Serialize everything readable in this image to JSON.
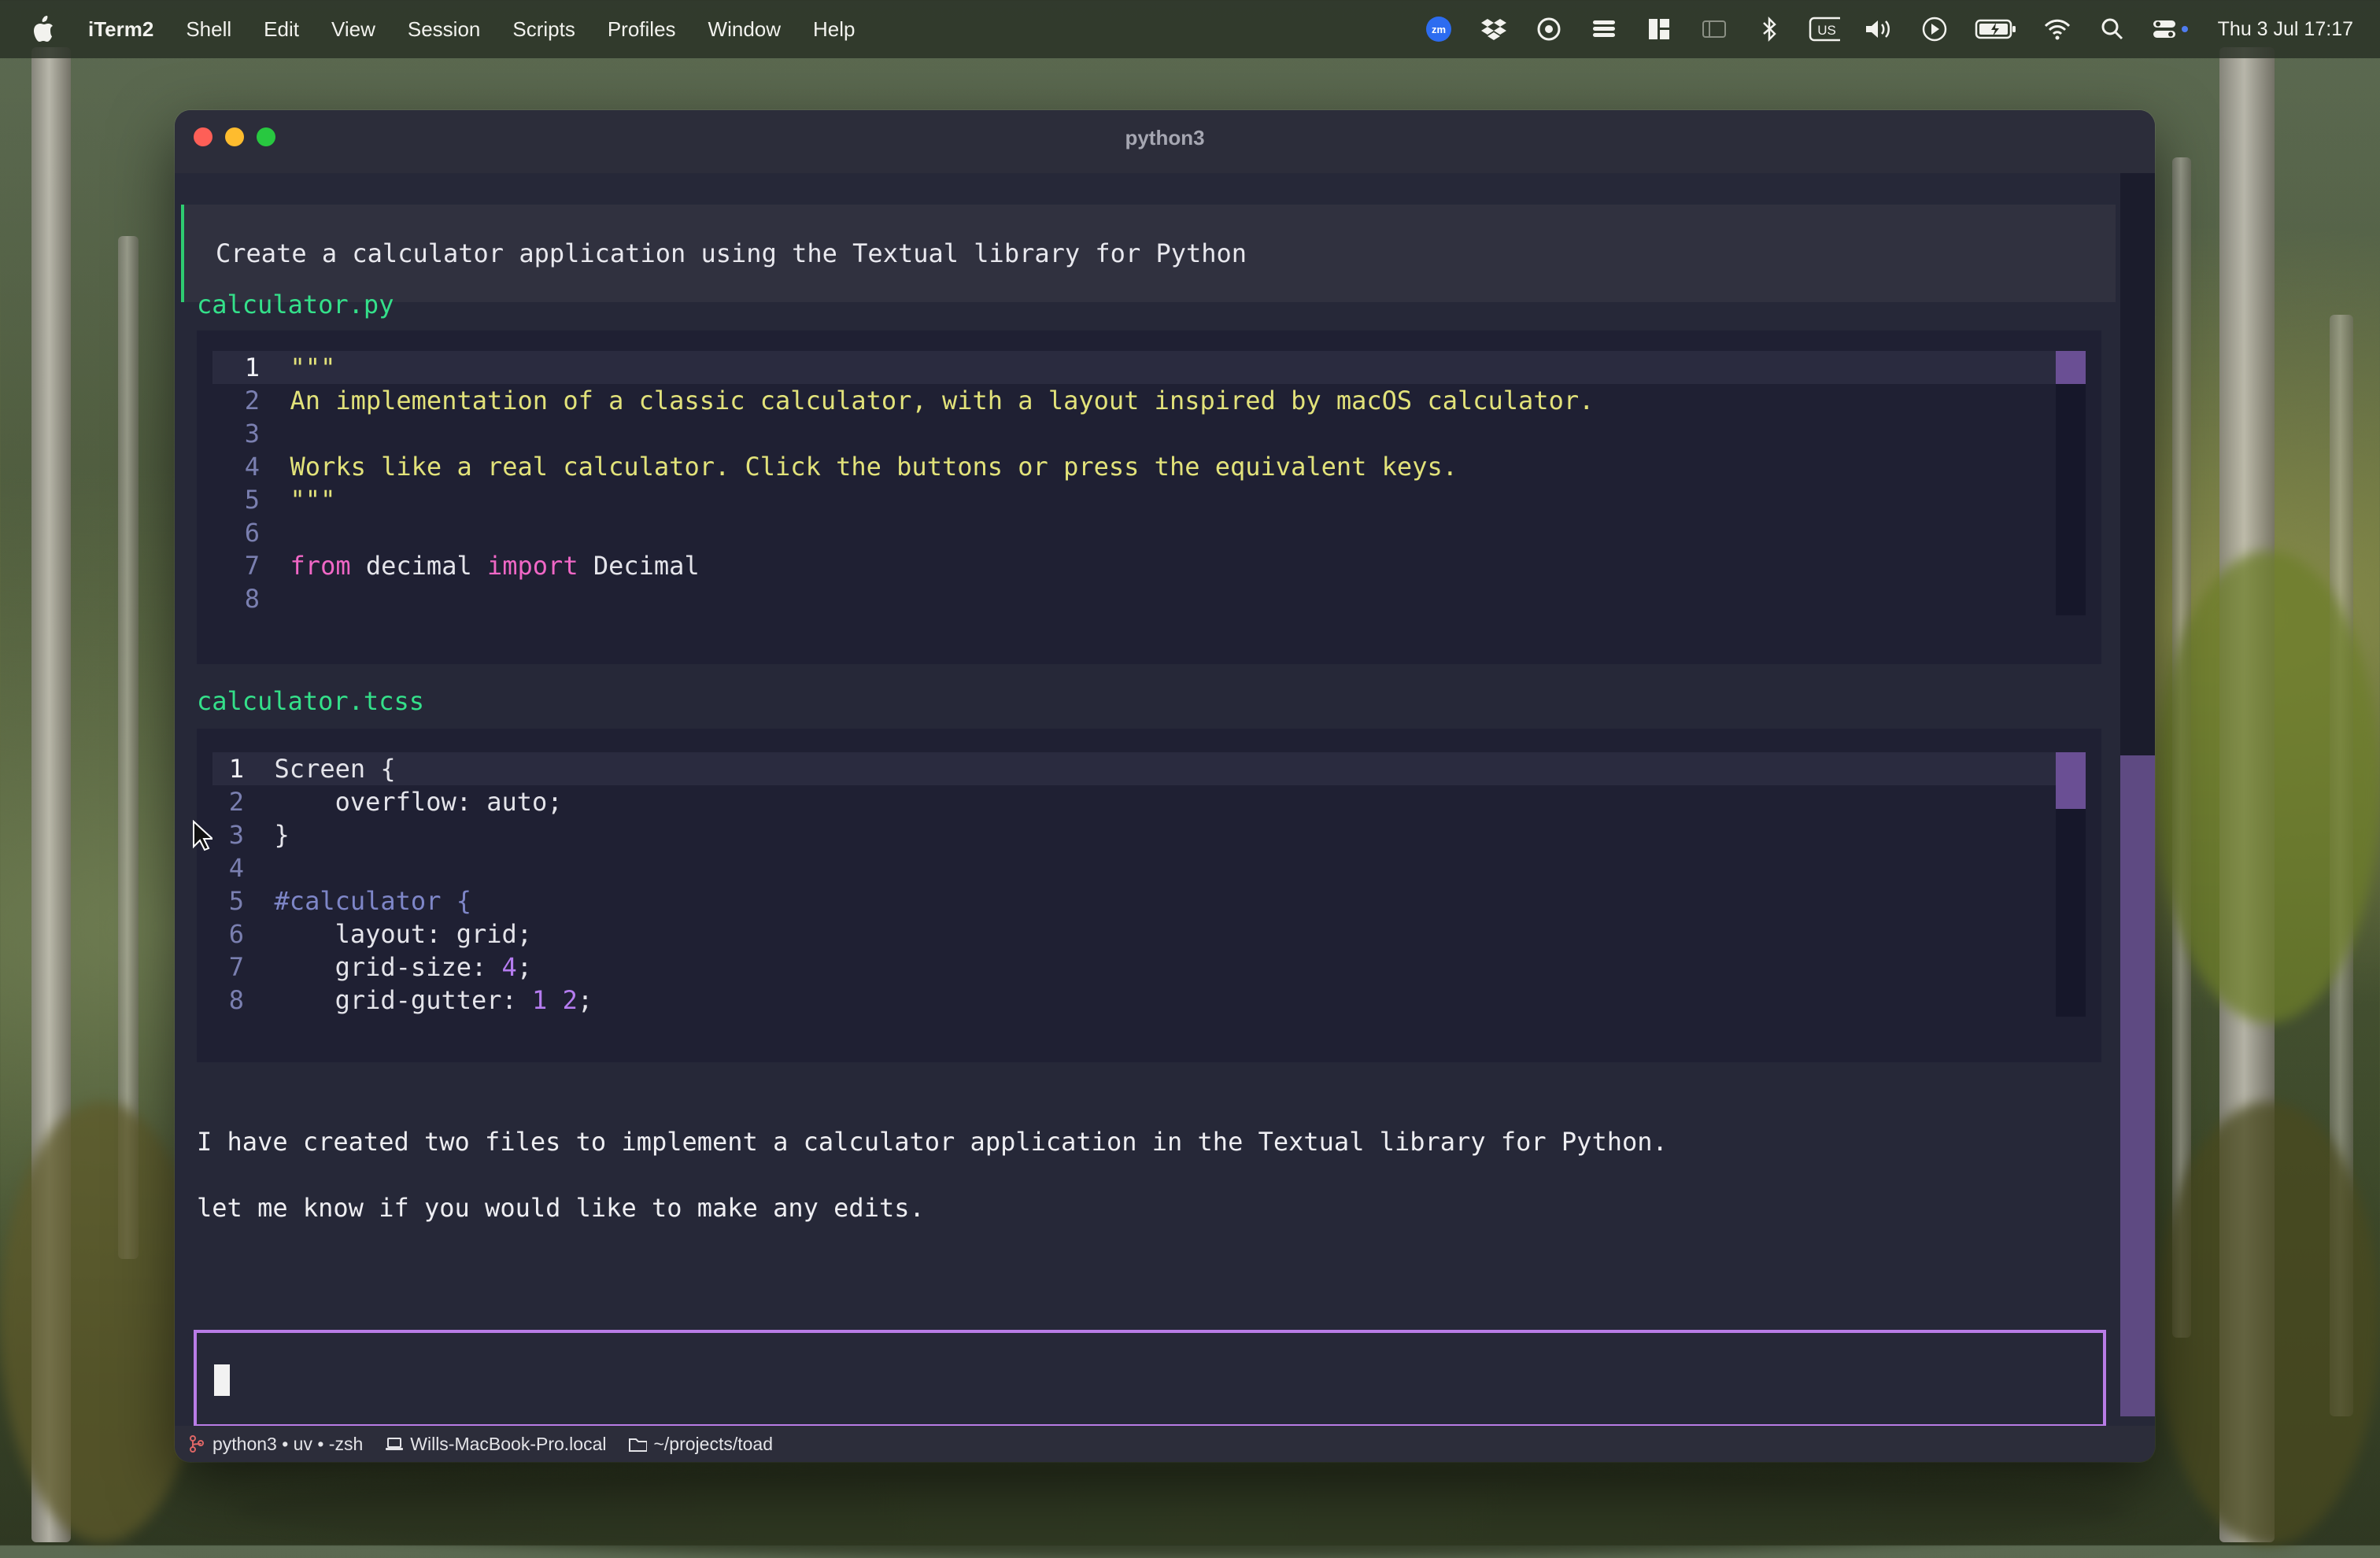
{
  "menubar": {
    "app_name": "iTerm2",
    "items": [
      "Shell",
      "Edit",
      "View",
      "Session",
      "Scripts",
      "Profiles",
      "Window",
      "Help"
    ],
    "zoom_badge": "zm",
    "keyboard_layout": "US",
    "clock": "Thu 3 Jul  17:17"
  },
  "window": {
    "title": "python3"
  },
  "chat": {
    "user_prompt": "Create a calculator application using the Textual library for Python",
    "files": [
      {
        "name": "calculator.py",
        "lines": [
          {
            "n": "1",
            "text": "\"\"\""
          },
          {
            "n": "2",
            "text": "An implementation of a classic calculator, with a layout inspired by macOS calculator."
          },
          {
            "n": "3",
            "text": ""
          },
          {
            "n": "4",
            "text": "Works like a real calculator. Click the buttons or press the equivalent keys."
          },
          {
            "n": "5",
            "text": "\"\"\""
          },
          {
            "n": "6",
            "text": ""
          },
          {
            "n": "7",
            "kw1": "from",
            "mid": " decimal ",
            "kw2": "import",
            "tail": " Decimal"
          },
          {
            "n": "8",
            "text": ""
          }
        ]
      },
      {
        "name": "calculator.tcss",
        "lines": [
          {
            "n": "1",
            "text": "Screen {"
          },
          {
            "n": "2",
            "text": "    overflow: auto;"
          },
          {
            "n": "3",
            "text": "}"
          },
          {
            "n": "4",
            "text": ""
          },
          {
            "n": "5",
            "text": "#calculator {"
          },
          {
            "n": "6",
            "text": "    layout: grid;"
          },
          {
            "n": "7",
            "pre": "    grid-size: ",
            "num": "4",
            "post": ";"
          },
          {
            "n": "8",
            "pre": "    grid-gutter: ",
            "num": "1 2",
            "post": ";"
          }
        ]
      }
    ],
    "response_lines": [
      "I have created two files to implement a calculator application in the Textual library for Python.",
      "let me know if you would like to make any edits."
    ]
  },
  "statusbar": {
    "job": "python3 • uv • -zsh",
    "host": "Wills-MacBook-Pro.local",
    "path": "~/projects/toad"
  },
  "colors": {
    "accent_purple": "#b97ce6",
    "file_label_green": "#34e08a",
    "prompt_border_green": "#2ecc71",
    "string_yellow": "#e2e27a",
    "keyword_pink": "#f067c6"
  }
}
